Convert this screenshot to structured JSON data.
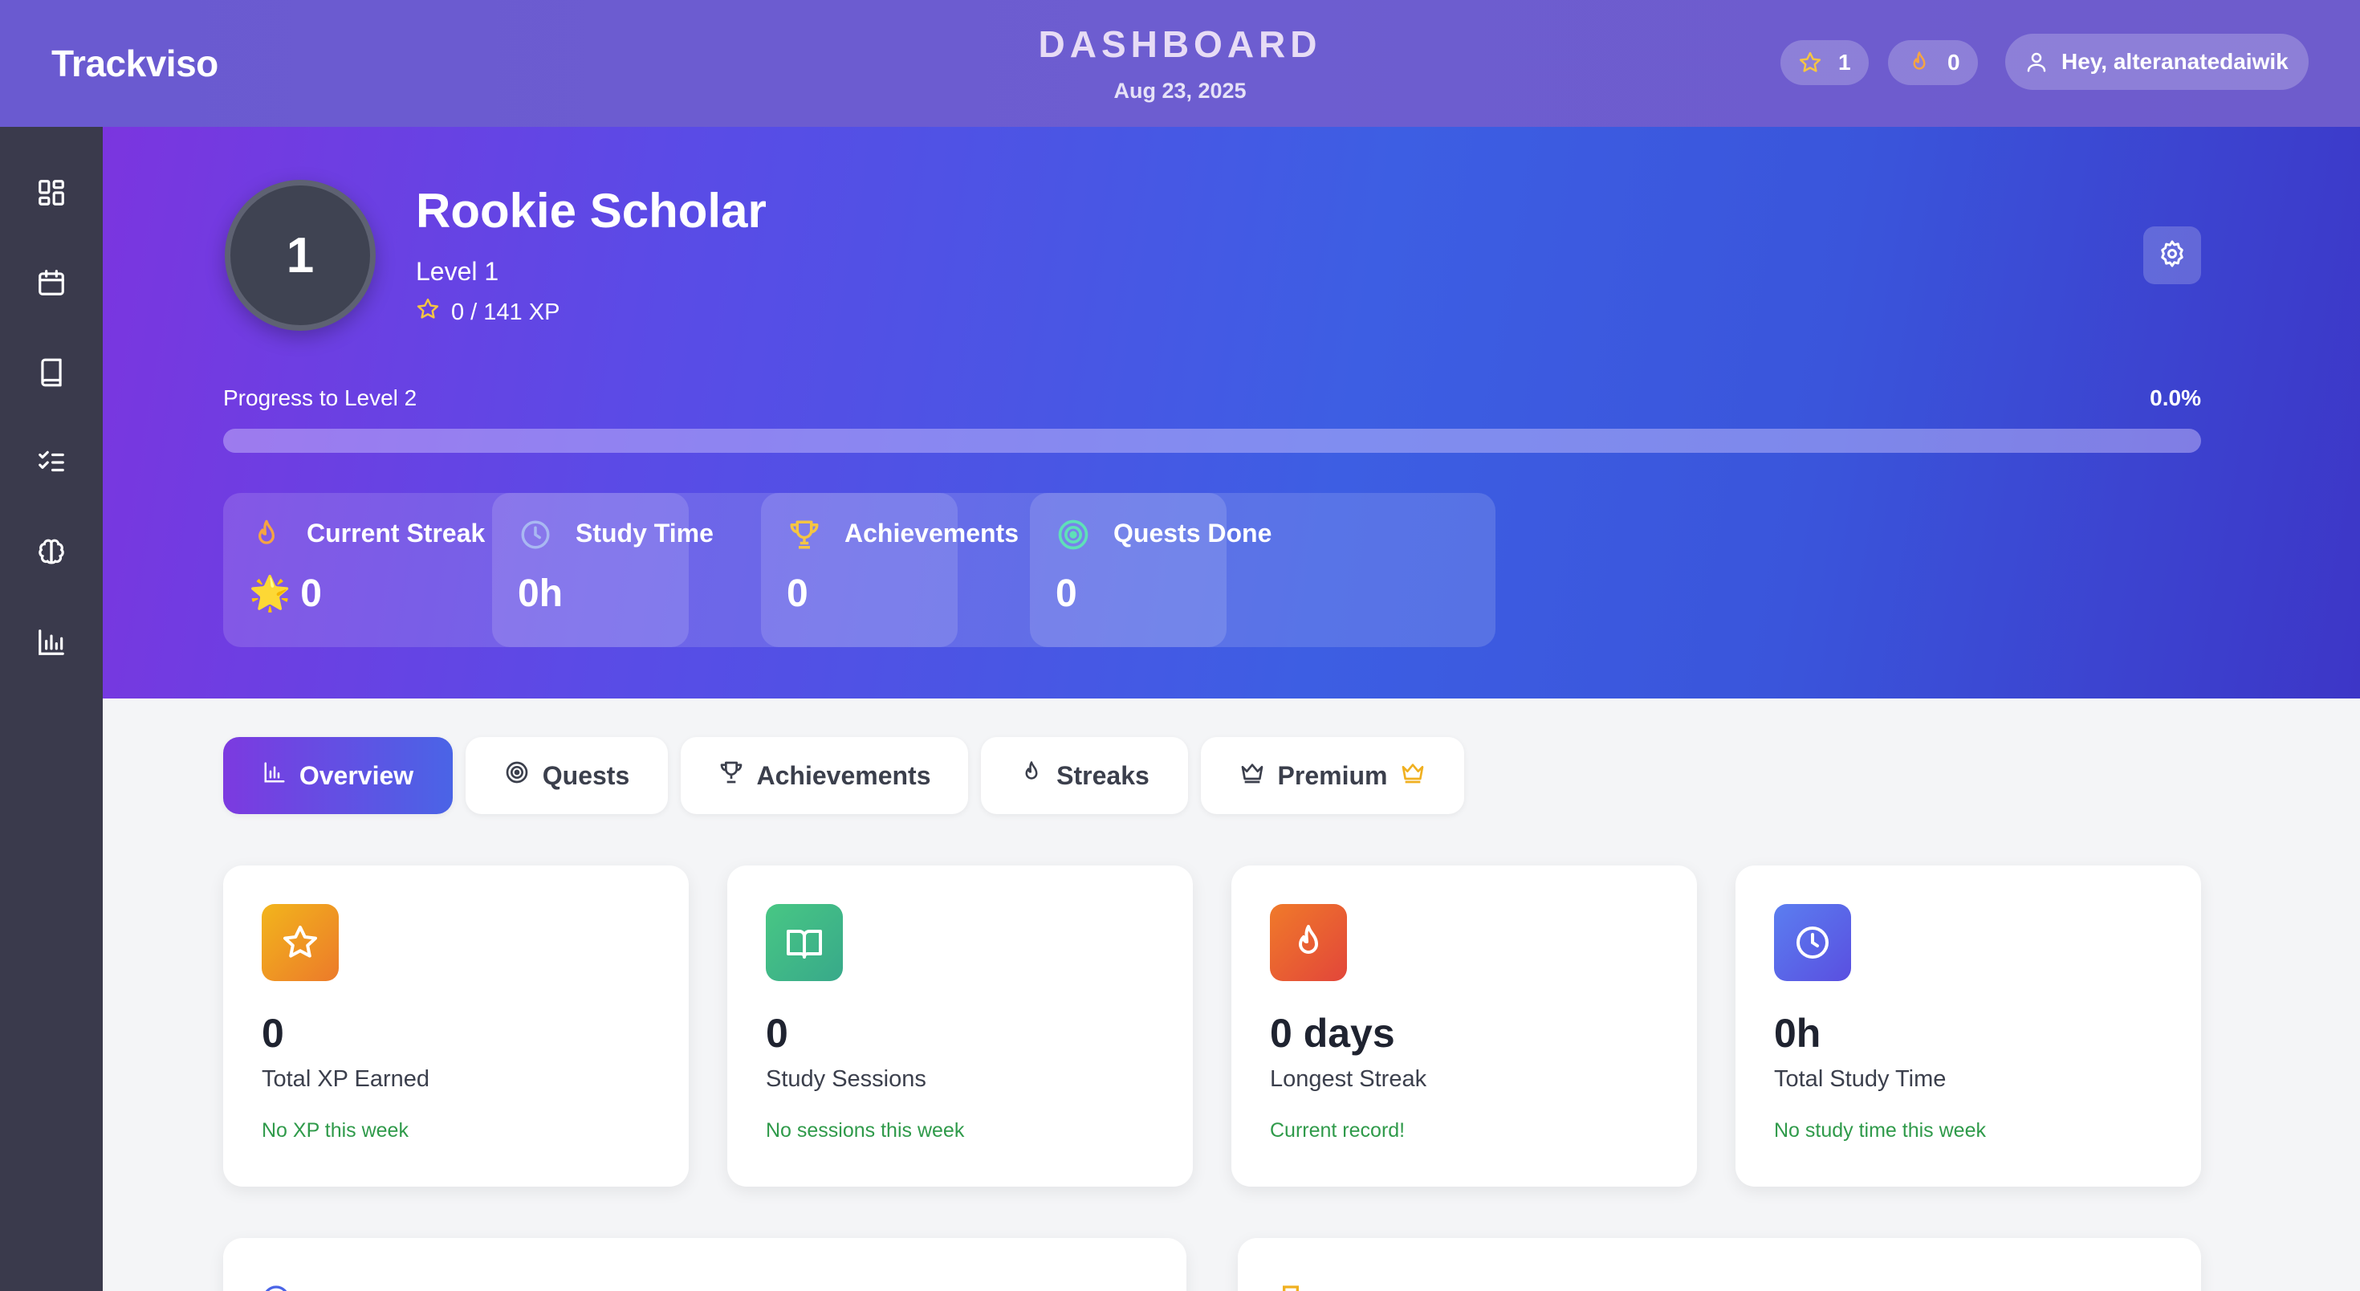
{
  "header": {
    "brand": "Trackviso",
    "title": "DASHBOARD",
    "date": "Aug 23, 2025",
    "stars": "1",
    "flames": "0",
    "greeting": "Hey, alteranatedaiwik"
  },
  "sidebar": {
    "items": [
      {
        "icon": "dashboard-icon"
      },
      {
        "icon": "calendar-icon"
      },
      {
        "icon": "book-icon"
      },
      {
        "icon": "checklist-icon"
      },
      {
        "icon": "brain-icon"
      },
      {
        "icon": "bar-chart-icon"
      }
    ]
  },
  "hero": {
    "level_number": "1",
    "rank_title": "Rookie Scholar",
    "level_label": "Level 1",
    "xp": "0 / 141 XP",
    "progress_label": "Progress to Level 2",
    "progress_percent": "0.0%",
    "progress_fraction": 0.0,
    "stats": [
      {
        "label": "Current Streak",
        "value": "0",
        "icon": "flame-icon",
        "prefix": "🌟"
      },
      {
        "label": "Study Time",
        "value": "0h",
        "icon": "clock-icon"
      },
      {
        "label": "Achievements",
        "value": "0",
        "icon": "trophy-icon"
      },
      {
        "label": "Quests Done",
        "value": "0",
        "icon": "target-icon"
      }
    ]
  },
  "tabs": [
    {
      "label": "Overview",
      "icon": "bar-chart-icon",
      "active": true
    },
    {
      "label": "Quests",
      "icon": "target-icon"
    },
    {
      "label": "Achievements",
      "icon": "trophy-icon"
    },
    {
      "label": "Streaks",
      "icon": "flame-icon"
    },
    {
      "label": "Premium",
      "icon": "crown-icon",
      "badge": "crown-icon"
    }
  ],
  "cards": [
    {
      "value": "0",
      "label": "Total XP Earned",
      "note": "No XP this week",
      "icon": "star-icon",
      "color": "#f0a020"
    },
    {
      "value": "0",
      "label": "Study Sessions",
      "note": "No sessions this week",
      "icon": "open-book-icon",
      "color": "#3fb87a"
    },
    {
      "value": "0 days",
      "label": "Longest Streak",
      "note": "Current record!",
      "icon": "flame-icon",
      "color": "#ee5a2a"
    },
    {
      "value": "0h",
      "label": "Total Study Time",
      "note": "No study time this week",
      "icon": "clock-icon",
      "color": "#4a63e0"
    }
  ],
  "colors": {
    "accent_purple": "#7c3ae0",
    "accent_blue": "#4a64e6",
    "note_green": "#2f9a4a"
  }
}
